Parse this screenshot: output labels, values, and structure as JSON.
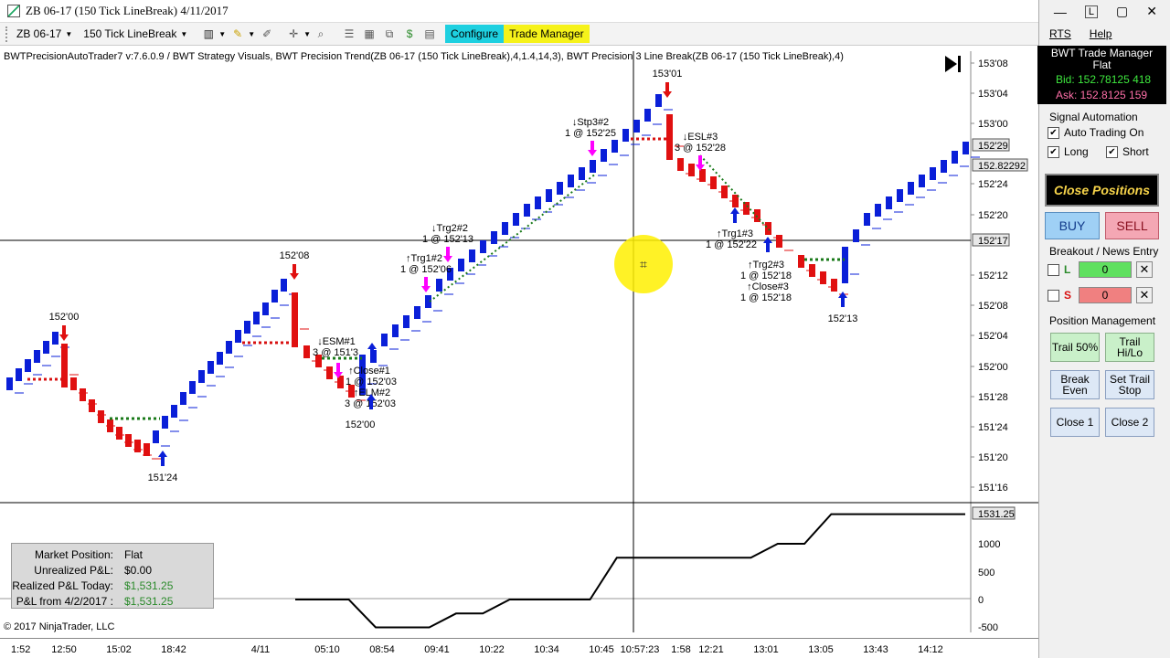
{
  "window": {
    "title": "ZB 06-17 (150 Tick LineBreak) 4/11/2017",
    "controls": [
      "—",
      "▢",
      "✕"
    ],
    "pin_label": "L"
  },
  "toolbar": {
    "instrument": "ZB 06-17",
    "period": "150 Tick LineBreak",
    "configure_label": "Configure",
    "trade_manager_label": "Trade Manager"
  },
  "chart": {
    "study_line": "BWTPrecisionAutoTrader7 v:7.6.0.9 / BWT Strategy Visuals, BWT Precision Trend(ZB 06-17 (150 Tick LineBreak),4,1.4,14,3), BWT Precision 3 Line Break(ZB 06-17 (150 Tick LineBreak),4)",
    "price_ticks": [
      "153'08",
      "153'04",
      "153'00",
      "152'24",
      "152'20",
      "152'12",
      "152'08",
      "152'04",
      "152'00",
      "151'28",
      "151'24",
      "151'20",
      "151'16"
    ],
    "price_tags": [
      "152'29",
      "152.82292",
      "152'17"
    ],
    "pnl_ticks": [
      "1000",
      "500",
      "0",
      "-500"
    ],
    "pnl_tag": "1531.25",
    "time_ticks": [
      "1:52",
      "12:50",
      "15:02",
      "18:42",
      "4/11",
      "05:10",
      "08:54",
      "09:41",
      "10:22",
      "10:34",
      "10:45",
      "10:57:23",
      "1:58",
      "12:21",
      "13:01",
      "13:05",
      "13:43",
      "14:12"
    ],
    "annotations": [
      {
        "text": "152'00"
      },
      {
        "text": "151'24"
      },
      {
        "text": "152'08"
      },
      {
        "text": "↓ESM#1"
      },
      {
        "text": "3 @ 151'3"
      },
      {
        "text": "↑Close#1"
      },
      {
        "text": "1 @ 152'03"
      },
      {
        "text": "↑ELM#2"
      },
      {
        "text": "3 @ 152'03"
      },
      {
        "text": "152'00"
      },
      {
        "text": "↑Trg1#2"
      },
      {
        "text": "1 @ 152'06"
      },
      {
        "text": "↓Trg2#2"
      },
      {
        "text": "1 @ 152'13"
      },
      {
        "text": "↓Stp3#2"
      },
      {
        "text": "1 @ 152'25"
      },
      {
        "text": "153'01"
      },
      {
        "text": "↓ESL#3"
      },
      {
        "text": "3 @ 152'28"
      },
      {
        "text": "↑Trg1#3"
      },
      {
        "text": "1 @ 152'22"
      },
      {
        "text": "↑Trg2#3"
      },
      {
        "text": "1 @ 152'18"
      },
      {
        "text": "↑Close#3"
      },
      {
        "text": "1 @ 152'18"
      },
      {
        "text": "152'13"
      }
    ],
    "colors": {
      "up": "#0a1fd8",
      "down": "#e01010",
      "profit": "#1a7a1a",
      "loss": "#d81010",
      "trigger": "#ff00ff"
    },
    "chart_data": {
      "type": "line",
      "series": [
        {
          "values": [
            0,
            0,
            0,
            -500,
            -500,
            -500,
            -250,
            -250,
            0,
            0,
            0,
            0,
            750,
            750,
            750,
            750,
            750,
            750,
            1000,
            1000,
            1531.25,
            1531.25,
            1531.25,
            1531.25,
            1531.25,
            1531.25
          ]
        }
      ]
    }
  },
  "pnl_box": {
    "rows": [
      {
        "label": "Market Position:",
        "value": "Flat"
      },
      {
        "label": "Unrealized P&L:",
        "value": "$0.00"
      },
      {
        "label": "Realized P&L Today:",
        "value": "$1,531.25"
      },
      {
        "label": "P&L from 4/2/2017 :",
        "value": "$1,531.25"
      }
    ]
  },
  "copyright": "© 2017 NinjaTrader, LLC",
  "menu": {
    "rts": "RTS",
    "help": "Help"
  },
  "trade_manager": {
    "title": "BWT Trade Manager",
    "status": "Flat",
    "bid": "Bid: 152.78125 418",
    "ask": "Ask: 152.8125 159"
  },
  "signal_automation": {
    "title": "Signal Automation",
    "auto_trading": "Auto Trading On",
    "long": "Long",
    "short": "Short"
  },
  "close_positions": "Close Positions",
  "buy": "BUY",
  "sell": "SELL",
  "breakout": {
    "title": "Breakout / News Entry",
    "long_label": "L",
    "short_label": "S",
    "long_qty": "0",
    "short_qty": "0"
  },
  "position_mgmt": {
    "title": "Position Management",
    "trail50": "Trail 50%",
    "trail_hilo": "Trail Hi/Lo",
    "break_even": "Break Even",
    "set_trail_stop": "Set Trail Stop",
    "close1": "Close 1",
    "close2": "Close 2"
  }
}
